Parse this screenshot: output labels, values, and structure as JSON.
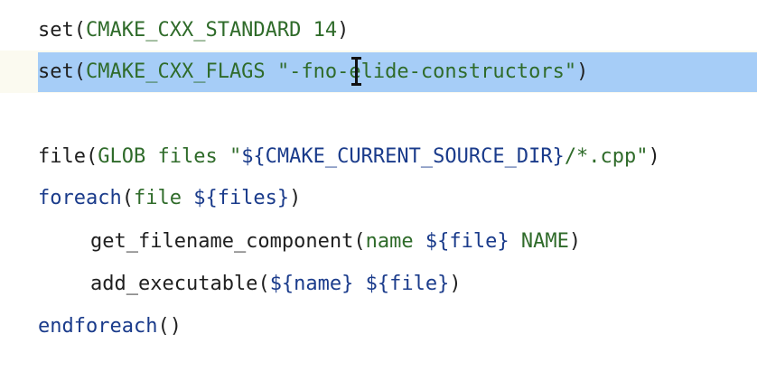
{
  "editor": {
    "lines": [
      {
        "fn": "set",
        "open": "(",
        "arg1": "CMAKE_CXX_STANDARD",
        "space": " ",
        "arg2": "14",
        "close": ")"
      },
      {
        "fn": "set",
        "open": "(",
        "arg1": "CMAKE_CXX_FLAGS",
        "space": " ",
        "str": "\"-fno-elide-constructors\"",
        "close": ")"
      },
      {
        "fn": "file",
        "open": "(",
        "arg1": "GLOB files ",
        "str_a": "\"",
        "var": "${CMAKE_CURRENT_SOURCE_DIR}",
        "str_b": "/*.cpp\"",
        "close": ")"
      },
      {
        "fn": "foreach",
        "open": "(",
        "arg1": "file ",
        "var": "${files}",
        "close": ")"
      },
      {
        "fn": "get_filename_component",
        "open": "(",
        "arg1": "name ",
        "var": "${file}",
        "arg2": " NAME",
        "close": ")"
      },
      {
        "fn": "add_executable",
        "open": "(",
        "var1": "${name}",
        "space": " ",
        "var2": "${file}",
        "close": ")"
      },
      {
        "fn": "endforeach",
        "parens": "()"
      }
    ],
    "colors": {
      "selection": "#a6cdf7",
      "keyword": "#1a3b8b",
      "string": "#2f6b2a",
      "current_line": "#fbfaf0"
    },
    "cursor_icon": "text-cursor-ibeam-icon"
  }
}
